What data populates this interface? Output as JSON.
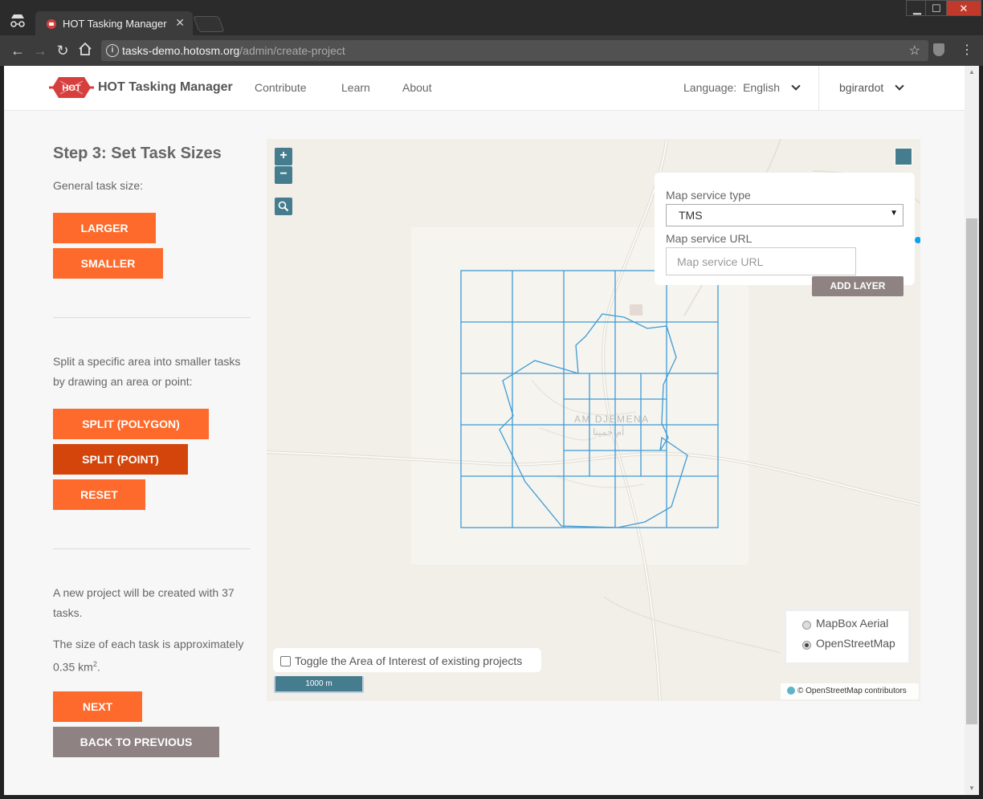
{
  "browser": {
    "tab_title": "HOT Tasking Manager",
    "url_host": "tasks-demo.hotosm.org",
    "url_path": "/admin/create-project"
  },
  "header": {
    "logo_text": "HOT",
    "site_name": "HOT Tasking Manager",
    "nav": [
      "Contribute",
      "Learn",
      "About"
    ],
    "language_label": "Language:",
    "language_value": "English",
    "user": "bgirardot"
  },
  "step": {
    "title": "Step 3: Set Task Sizes",
    "general_label": "General task size:",
    "larger": "LARGER",
    "smaller": "SMALLER",
    "split_text_1": "Split a specific area into smaller tasks",
    "split_text_2": "by drawing an area or point:",
    "split_polygon": "SPLIT (POLYGON)",
    "split_point": "SPLIT (POINT)",
    "reset": "RESET",
    "summary_1": "A new project will be created with 37",
    "summary_2": "tasks.",
    "size_1": "The size of each task is approximately",
    "size_2": "0.35 km",
    "size_sup": "2",
    "size_end": ".",
    "next": "NEXT",
    "back": "BACK TO PREVIOUS"
  },
  "map": {
    "zoom_in": "+",
    "zoom_out": "−",
    "layer_panel": {
      "service_type_label": "Map service type",
      "service_type_value": "TMS",
      "service_url_label": "Map service URL",
      "service_url_placeholder": "Map service URL",
      "add_layer": "ADD LAYER"
    },
    "place_name": "AM DJEMENA",
    "place_name_ar": "أم جمينا",
    "aoi_toggle": "Toggle the Area of Interest of existing projects",
    "scale": "1000 m",
    "basemaps": [
      "MapBox Aerial",
      "OpenStreetMap"
    ],
    "basemap_selected": "OpenStreetMap",
    "attribution_prefix": "©",
    "attribution_link": "OpenStreetMap",
    "attribution_suffix": "contributors",
    "accent": "#467d8e",
    "grid_color": "#3e9bd4"
  },
  "colors": {
    "orange": "#fd6a2b",
    "orange_dark": "#d3450b",
    "grey_btn": "#8f8282"
  }
}
